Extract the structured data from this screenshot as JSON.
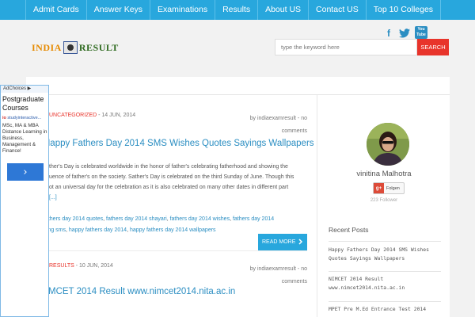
{
  "nav": {
    "items": [
      "Admit Cards",
      "Answer Keys",
      "Examinations",
      "Results",
      "About US",
      "Contact US",
      "Top 10 Colleges"
    ]
  },
  "header": {
    "logo": {
      "left": "INDIA",
      "right": "RESULT"
    },
    "social": {
      "facebook": "f",
      "twitter": "t",
      "youtube_top": "You",
      "youtube_bottom": "Tube"
    },
    "search": {
      "placeholder": "type the keyword here",
      "button": "SEARCH"
    }
  },
  "posts": [
    {
      "category": "UNCATEGORIZED",
      "date": "- 14 JUN, 2014",
      "byline": "by indiaexamresult - no comments",
      "title": "Happy Fathers Day 2014 SMS Wishes Quotes Sayings Wallpapers",
      "body": [
        "ther's Day is celebrated worldwide in the honor of father's celebrating fatherhood and showing the",
        "uence of father's on the society. Sather's Day is celebrated on the third Sunday of June. Though this",
        "ot an universal day for the celebration as it is also celebrated on many other dates in different part",
        "[...]"
      ],
      "tags": [
        "fathers day 2014 quotes",
        "fathers day 2014 shayari",
        "fathers day 2014 wishes",
        "fathers day 2014",
        "ning sms",
        "happy fathers day 2014",
        "happy fathers day 2014 wallpapers"
      ],
      "read_more": "READ MORE"
    },
    {
      "category": "RESULTS",
      "date": "- 10 JUN, 2014",
      "byline": "by indiaexamresult - no comments",
      "title": "MCET 2014 Result www.nimcet2014.nita.ac.in"
    }
  ],
  "sidebar": {
    "author": "vinitina Malhotra",
    "gplus_icon": "g+",
    "gplus_label": "Folgen",
    "followers": "223 Follower",
    "recent_heading": "Recent Posts",
    "recent_posts": [
      "Happy Fathers Day 2014 SMS Wishes Quotes Sayings Wallpapers",
      "NIMCET 2014 Result www.nimcet2014.nita.ac.in",
      "MPET Pre M.Ed Entrance Test 2014"
    ]
  },
  "ad": {
    "choices": "AdChoices ▶",
    "title": "Postgraduate Courses",
    "source_icon": "io",
    "source": "studyinteractive...",
    "description": "MSc, MA & MBA Distance Learning in Business, Management & Finance!",
    "cta": "›"
  },
  "colors": {
    "nav": "#28a7dd",
    "accent_red": "#e8342b",
    "link": "#2b8ec2"
  }
}
